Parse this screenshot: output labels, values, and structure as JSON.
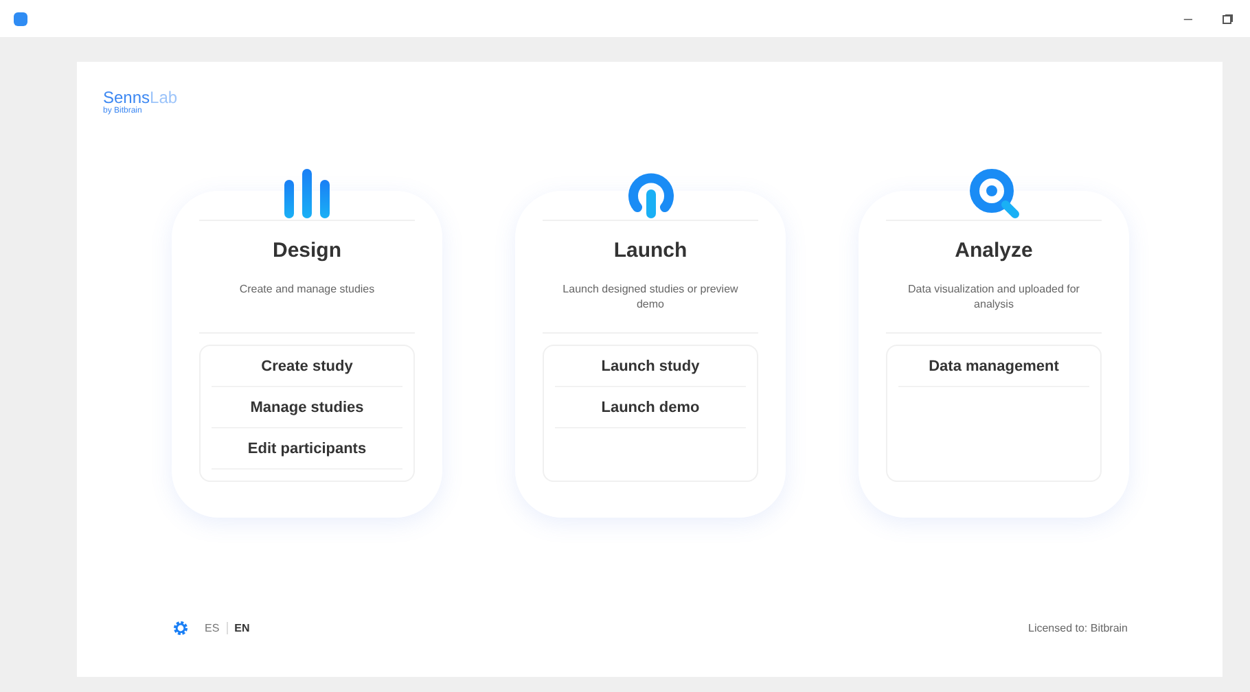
{
  "logo": {
    "name": "Senns",
    "suffix": "Lab",
    "byline": "by Bitbrain"
  },
  "window_controls": [
    "–"
  ],
  "cards": [
    {
      "kind": "design",
      "title": "Design",
      "description": "Create and manage studies",
      "actions": [
        "Create study",
        "Manage studies",
        "Edit participants"
      ]
    },
    {
      "kind": "launch",
      "title": "Launch",
      "description": "Launch designed studies or preview demo",
      "actions": [
        "Launch study",
        "Launch demo"
      ]
    },
    {
      "kind": "analyze",
      "title": "Analyze",
      "description": "Data visualization and uploaded for analysis",
      "actions": [
        "Data management"
      ]
    }
  ],
  "languages": [
    {
      "label": "ES",
      "selected": false
    },
    {
      "label": "EN",
      "selected": true
    }
  ],
  "license": "Licensed to: Bitbrain"
}
